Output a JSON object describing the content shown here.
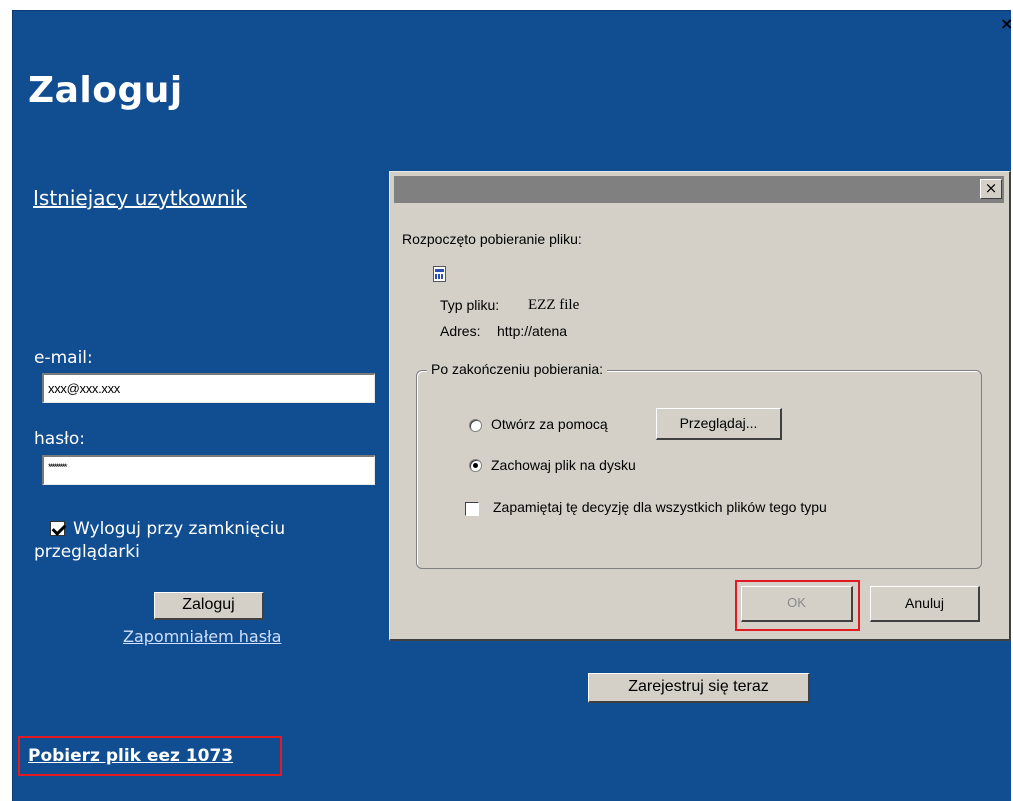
{
  "page": {
    "close_glyph": "×",
    "title": "Zaloguj",
    "existing_user": "Istniejacy uzytkownik",
    "email_label": "e-mail:",
    "email_value": "xxx@xxx.xxx",
    "password_label": "hasło:",
    "password_value": "*********",
    "remember_line1": "Wyloguj przy zamknięciu",
    "remember_line2": "przeglądarki",
    "login_button": "Zaloguj",
    "forgot_link": "Zapomniałem hasła",
    "register_button": "Zarejestruj się teraz",
    "download_link": "Pobierz plik eez 1073"
  },
  "dialog": {
    "close_glyph": "×",
    "heading": "Rozpoczęto pobieranie pliku:",
    "file_icon": "document-icon",
    "type_label": "Typ pliku:",
    "type_value": "EZZ file",
    "address_label": "Adres:",
    "address_value": "http://atena",
    "group_label": "Po zakończeniu pobierania:",
    "option_open": "Otwórz za pomocą",
    "browse_button": "Przeglądaj...",
    "option_save": "Zachowaj plik na dysku",
    "option_save_selected": true,
    "remember_decision": "Zapamiętaj tę decyzję dla wszystkich plików tego typu",
    "ok_button": "OK",
    "cancel_button": "Anuluj"
  },
  "colors": {
    "page_background": "#114d91",
    "dialog_background": "#d4d0c8",
    "highlight": "#e21b23"
  }
}
